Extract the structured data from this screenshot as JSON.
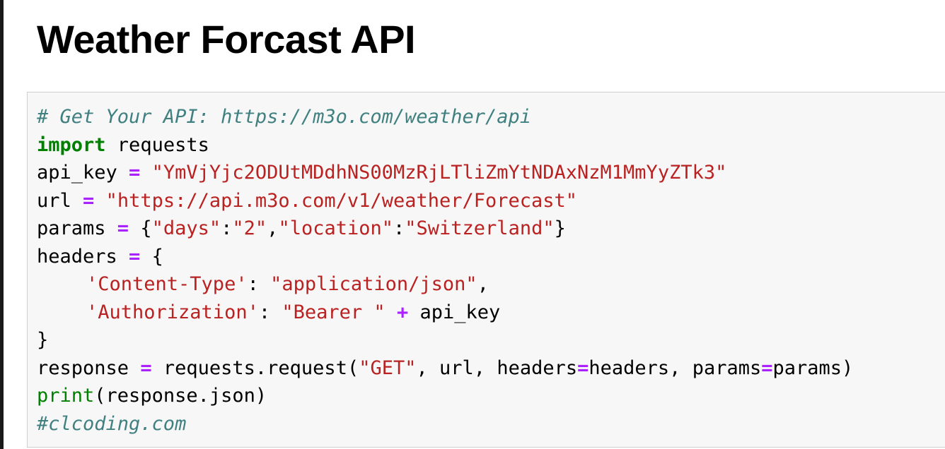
{
  "page": {
    "title": "Weather Forcast API"
  },
  "colors": {
    "comment": "#408080",
    "keyword": "#008000",
    "string": "#BA2121",
    "operator": "#AA22FF",
    "cell_background": "#f7f7f7",
    "cell_border": "#cfcfcf"
  },
  "code_cell": {
    "lines": [
      [
        {
          "type": "comment",
          "text": "# Get Your API: https://m3o.com/weather/api"
        }
      ],
      [
        {
          "type": "keyword",
          "text": "import"
        },
        {
          "type": "name",
          "text": " requests"
        }
      ],
      [
        {
          "type": "name",
          "text": "api_key "
        },
        {
          "type": "operator",
          "text": "="
        },
        {
          "type": "name",
          "text": " "
        },
        {
          "type": "string",
          "text": "\"YmVjYjc2ODUtMDdhNS00MzRjLTliZmYtNDAxNzM1MmYyZTk3\""
        }
      ],
      [
        {
          "type": "name",
          "text": "url "
        },
        {
          "type": "operator",
          "text": "="
        },
        {
          "type": "name",
          "text": " "
        },
        {
          "type": "string",
          "text": "\"https://api.m3o.com/v1/weather/Forecast\""
        }
      ],
      [
        {
          "type": "name",
          "text": "params "
        },
        {
          "type": "operator",
          "text": "="
        },
        {
          "type": "punct",
          "text": " {"
        },
        {
          "type": "string",
          "text": "\"days\""
        },
        {
          "type": "punct",
          "text": ":"
        },
        {
          "type": "string",
          "text": "\"2\""
        },
        {
          "type": "punct",
          "text": ","
        },
        {
          "type": "string",
          "text": "\"location\""
        },
        {
          "type": "punct",
          "text": ":"
        },
        {
          "type": "string",
          "text": "\"Switzerland\""
        },
        {
          "type": "punct",
          "text": "}"
        }
      ],
      [
        {
          "type": "name",
          "text": "headers "
        },
        {
          "type": "operator",
          "text": "="
        },
        {
          "type": "punct",
          "text": " {"
        }
      ],
      [
        {
          "type": "indent",
          "text": ""
        },
        {
          "type": "string",
          "text": "'Content-Type'"
        },
        {
          "type": "punct",
          "text": ": "
        },
        {
          "type": "string",
          "text": "\"application/json\""
        },
        {
          "type": "punct",
          "text": ","
        }
      ],
      [
        {
          "type": "indent",
          "text": ""
        },
        {
          "type": "string",
          "text": "'Authorization'"
        },
        {
          "type": "punct",
          "text": ": "
        },
        {
          "type": "string",
          "text": "\"Bearer \""
        },
        {
          "type": "name",
          "text": " "
        },
        {
          "type": "operator",
          "text": "+"
        },
        {
          "type": "name",
          "text": " api_key"
        }
      ],
      [
        {
          "type": "punct",
          "text": "}"
        }
      ],
      [
        {
          "type": "name",
          "text": "response "
        },
        {
          "type": "operator",
          "text": "="
        },
        {
          "type": "name",
          "text": " requests"
        },
        {
          "type": "punct",
          "text": "."
        },
        {
          "type": "name",
          "text": "request"
        },
        {
          "type": "punct",
          "text": "("
        },
        {
          "type": "string",
          "text": "\"GET\""
        },
        {
          "type": "punct",
          "text": ", "
        },
        {
          "type": "name",
          "text": "url"
        },
        {
          "type": "punct",
          "text": ", "
        },
        {
          "type": "name",
          "text": "headers"
        },
        {
          "type": "operator",
          "text": "="
        },
        {
          "type": "name",
          "text": "headers"
        },
        {
          "type": "punct",
          "text": ", "
        },
        {
          "type": "name",
          "text": "params"
        },
        {
          "type": "operator",
          "text": "="
        },
        {
          "type": "name",
          "text": "params"
        },
        {
          "type": "punct",
          "text": ")"
        }
      ],
      [
        {
          "type": "builtin",
          "text": "print"
        },
        {
          "type": "punct",
          "text": "("
        },
        {
          "type": "name",
          "text": "response"
        },
        {
          "type": "punct",
          "text": "."
        },
        {
          "type": "name",
          "text": "json"
        },
        {
          "type": "punct",
          "text": ")"
        }
      ],
      [
        {
          "type": "comment",
          "text": "#clcoding.com"
        }
      ]
    ]
  }
}
